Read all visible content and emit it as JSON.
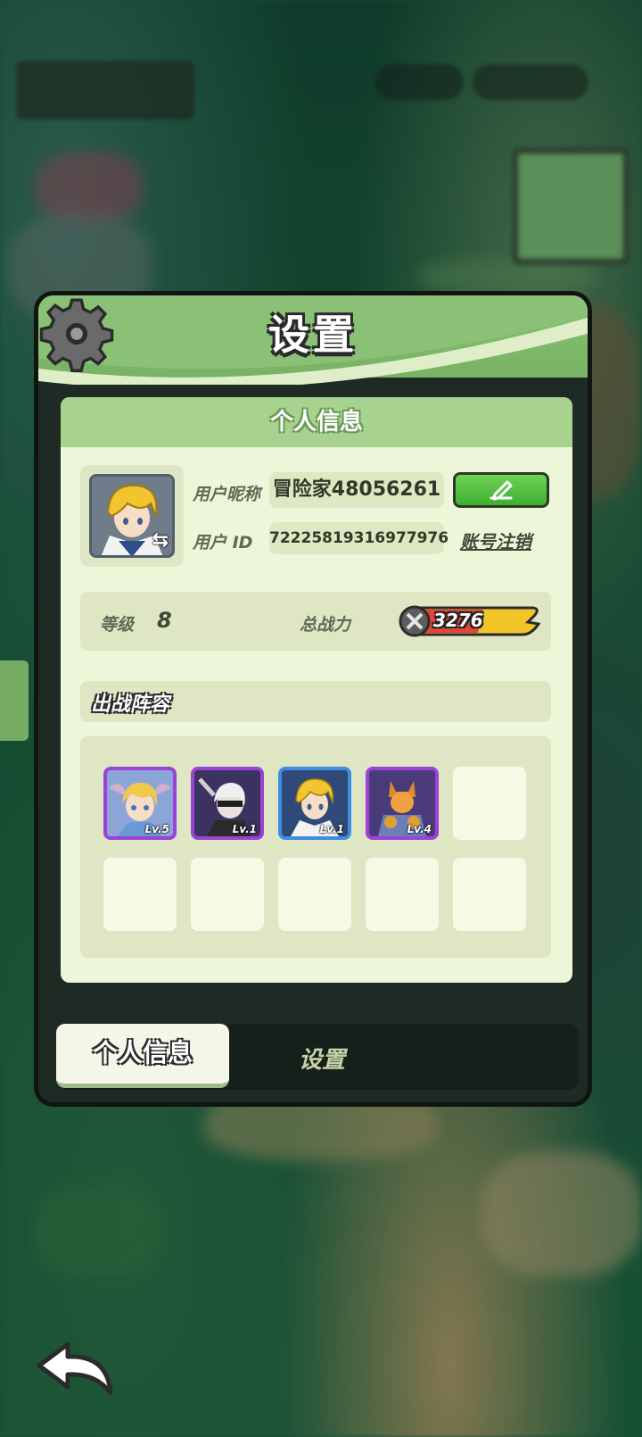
{
  "panel": {
    "title": "设置",
    "section_title": "个人信息",
    "profile": {
      "nickname_label": "用户昵称",
      "nickname": "冒险家48056261",
      "id_label": "用户 ID",
      "user_id": "72225819316977976",
      "logout_label": "账号注销"
    },
    "stats": {
      "level_label": "等级",
      "level": "8",
      "power_label": "总战力",
      "power": "3276"
    },
    "lineup": {
      "title": "出战阵容",
      "heroes": [
        {
          "level": "Lv.5"
        },
        {
          "level": "Lv.1"
        },
        {
          "level": "Lv.1"
        },
        {
          "level": "Lv.4"
        }
      ]
    },
    "tabs": {
      "active": "个人信息",
      "other": "设置"
    }
  },
  "colors": {
    "panel_header": "#8bc176",
    "card_bg": "#eef6d9",
    "edit_button": "#4fbf3e",
    "hero_frame_purple": "#9d42d6",
    "hero_frame_blue": "#3e8de0"
  },
  "icons": [
    "gear-icon",
    "edit-pencil-icon",
    "swap-avatar-icon",
    "power-swords-icon",
    "back-arrow-icon"
  ]
}
